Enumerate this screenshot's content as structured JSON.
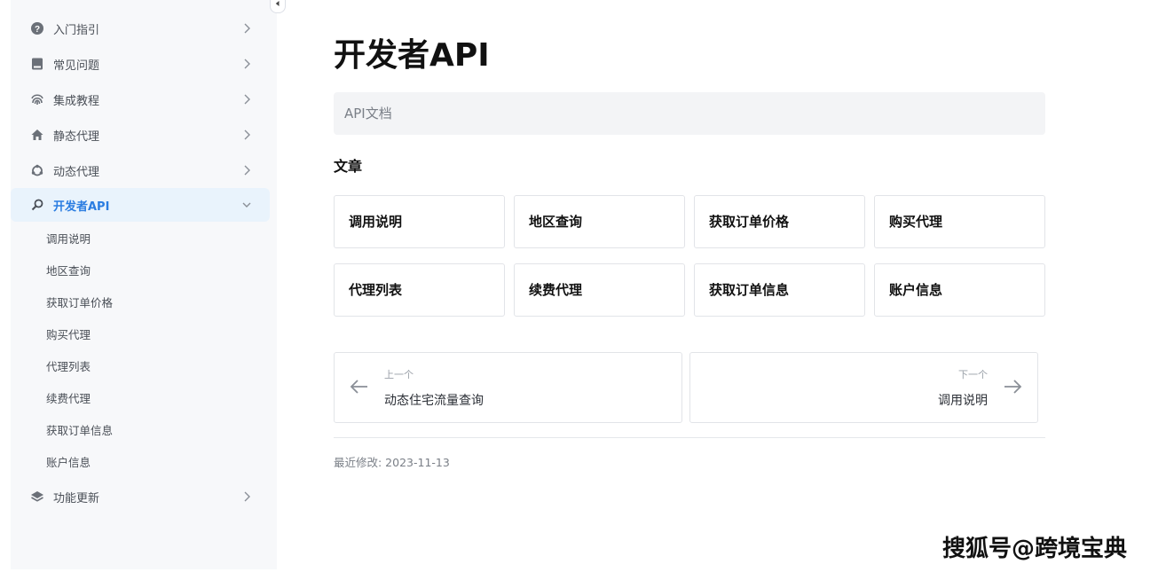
{
  "sidebar": {
    "items": [
      {
        "label": "入门指引",
        "icon": "question-circle-icon"
      },
      {
        "label": "常见问题",
        "icon": "book-icon"
      },
      {
        "label": "集成教程",
        "icon": "fingerprint-icon"
      },
      {
        "label": "静态代理",
        "icon": "home-icon"
      },
      {
        "label": "动态代理",
        "icon": "refresh-ring-icon"
      },
      {
        "label": "开发者API",
        "icon": "search-icon",
        "active": true
      },
      {
        "label": "功能更新",
        "icon": "layers-icon"
      }
    ],
    "sub_items": [
      "调用说明",
      "地区查询",
      "获取订单价格",
      "购买代理",
      "代理列表",
      "续费代理",
      "获取订单信息",
      "账户信息"
    ]
  },
  "main": {
    "title": "开发者API",
    "description": "API文档",
    "section_label": "文章",
    "cards": [
      "调用说明",
      "地区查询",
      "获取订单价格",
      "购买代理",
      "代理列表",
      "续费代理",
      "获取订单信息",
      "账户信息"
    ],
    "prev": {
      "hint": "上一个",
      "title": "动态住宅流量查询"
    },
    "next": {
      "hint": "下一个",
      "title": "调用说明"
    },
    "last_modified": "最近修改: 2023-11-13"
  },
  "watermark": "搜狐号@跨境宝典",
  "colors": {
    "accent": "#2b7de1",
    "active_bg": "#e9f3fc",
    "sidebar_bg": "#f7f8fa"
  }
}
